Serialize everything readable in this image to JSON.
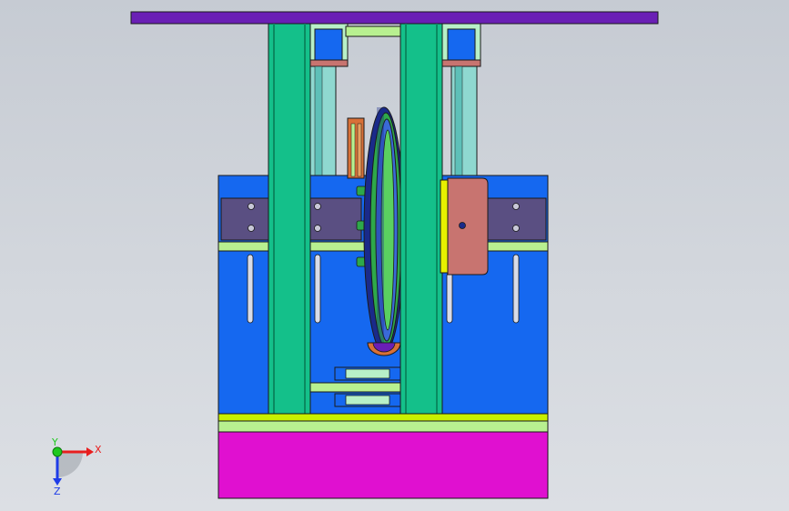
{
  "view": {
    "description_visible": false
  },
  "triad": {
    "x_label": "X",
    "y_label": "Y",
    "z_label": "Z",
    "colors": {
      "x": "#e81e1e",
      "y": "#1ec81e",
      "z": "#1e3ce8"
    }
  },
  "palette": {
    "top_beam": "#6a1fb5",
    "base_block": "#e010d0",
    "body_panel": "#1568f0",
    "column": "#14c08a",
    "rail_plate": "#5a4f82",
    "light_green_bar": "#b8f090",
    "yellow_green": "#c8f000",
    "bracket": "#c87470",
    "pulley_dark": "#1a2a8a",
    "pulley_green": "#2ea84a",
    "pulley_inner": "#3a6ad8",
    "outline": "#1a1a1a"
  }
}
